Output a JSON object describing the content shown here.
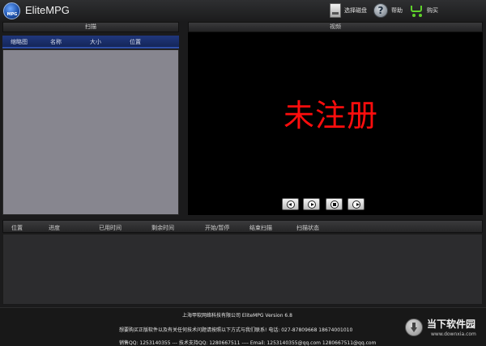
{
  "window": {
    "title": "EliteMPG",
    "logo_text": "MPG"
  },
  "toolbar": {
    "select_disk": "选择磁盘",
    "help": "帮助",
    "buy": "购买"
  },
  "scan_panel": {
    "title": "扫描",
    "columns": [
      "缩略图",
      "名称",
      "大小",
      "位置"
    ]
  },
  "video_panel": {
    "title": "视频",
    "watermark": "未注册",
    "controls": [
      "rewind",
      "play",
      "stop",
      "forward"
    ]
  },
  "tasks_panel": {
    "columns": [
      "位置",
      "进度",
      "已用时间",
      "剩余时间",
      "开始/暂停",
      "结束扫描",
      "扫描状态"
    ]
  },
  "footer": {
    "company": "上海甲软网络科技有限公司 EliteMPG Version 6.8",
    "contact": "想要购买正版软件以及有关任何技术问题请按照以下方式与我们联系! 电话: 027-87809668 18674001010",
    "support": "销售QQ: 1253140355 --- 技术支持QQ: 1280667511 ---- Email: 1253140355@qq.com 1280667511@qq.com"
  },
  "corner_watermark": {
    "name": "当下软件园",
    "site": "www.downxia.com"
  },
  "colors": {
    "watermark_red": "#ff0d0d",
    "scan_header_blue": "#1c3272",
    "list_bg": "#87868f"
  }
}
